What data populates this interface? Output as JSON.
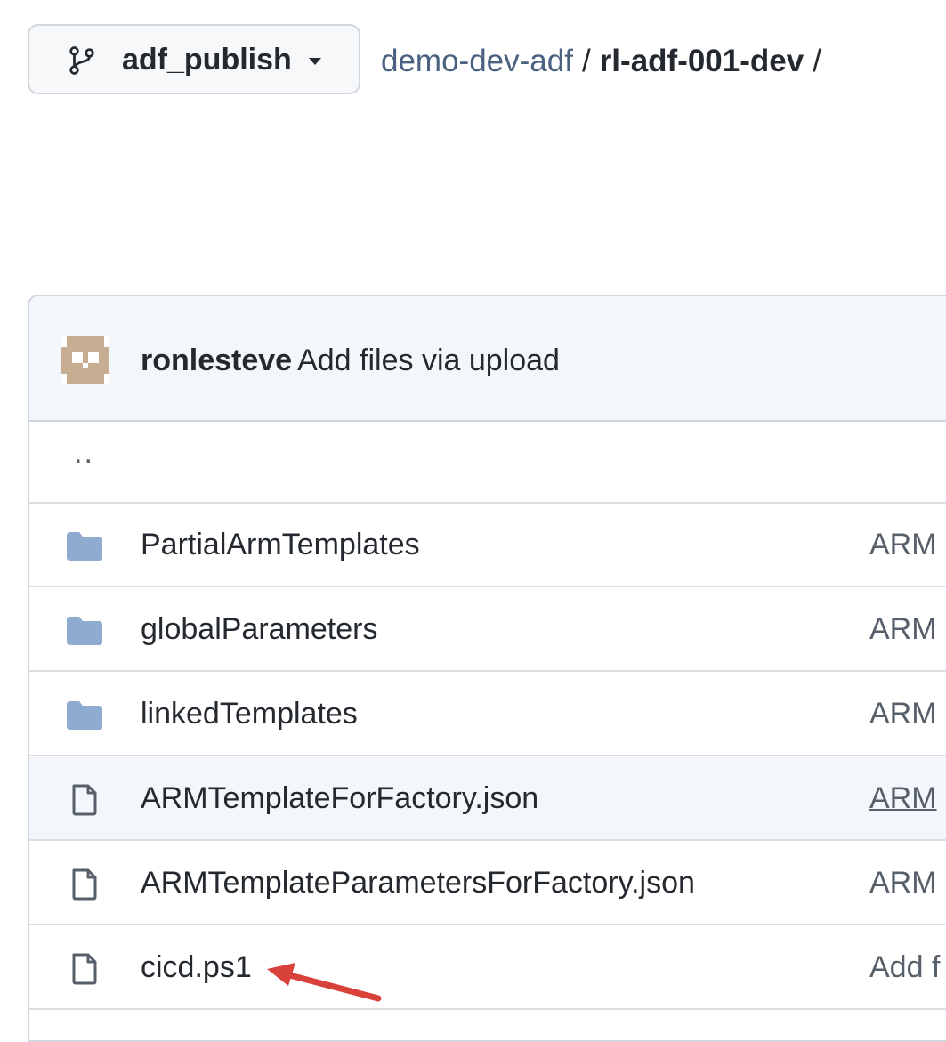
{
  "branch": {
    "name": "adf_publish",
    "icon": "git-branch-icon"
  },
  "breadcrumb": {
    "repo": "demo-dev-adf",
    "separator": "/",
    "folder": "rl-adf-001-dev",
    "trailing": "/"
  },
  "commit": {
    "author": "ronlesteve",
    "message": "Add files via upload"
  },
  "parent_link": "..",
  "files": [
    {
      "name": "PartialArmTemplates",
      "type": "folder",
      "message": "ARM"
    },
    {
      "name": "globalParameters",
      "type": "folder",
      "message": "ARM"
    },
    {
      "name": "linkedTemplates",
      "type": "folder",
      "message": "ARM"
    },
    {
      "name": "ARMTemplateForFactory.json",
      "type": "file",
      "message": "ARM"
    },
    {
      "name": "ARMTemplateParametersForFactory.json",
      "type": "file",
      "message": "ARM"
    },
    {
      "name": "cicd.ps1",
      "type": "file",
      "message": "Add f"
    }
  ],
  "colors": {
    "folder": "#8fabd0",
    "file_icon": "#57606a",
    "link": "#4a6180",
    "arrow": "#d9413b",
    "hover_row": "#f3f7fb"
  }
}
